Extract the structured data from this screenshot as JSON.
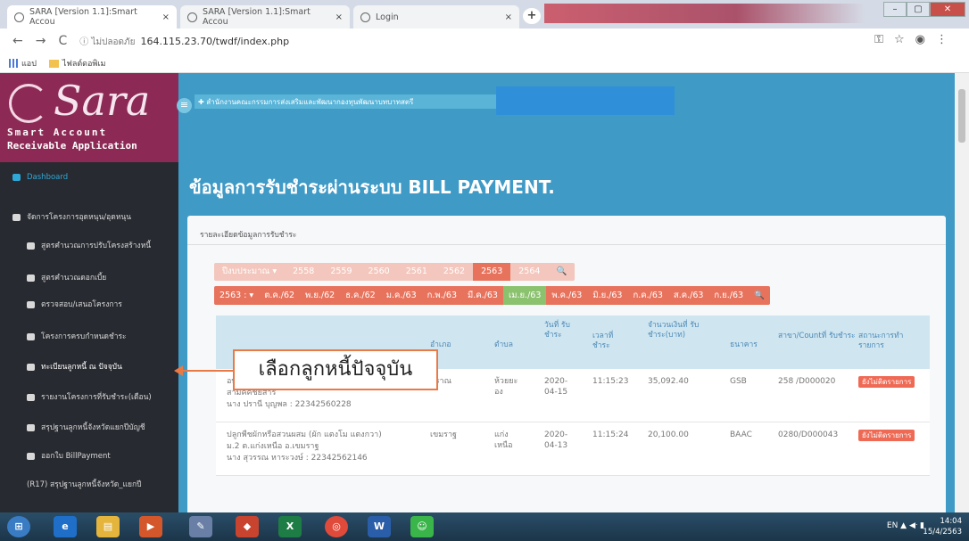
{
  "browser": {
    "tabs": [
      {
        "title": "SARA [Version 1.1]:Smart Accou",
        "close": "×"
      },
      {
        "title": "SARA [Version 1.1]:Smart Accou",
        "close": "×"
      },
      {
        "title": "Login",
        "close": "×"
      }
    ],
    "new_tab": "+",
    "window_controls": {
      "minimize": "–",
      "maximize": "▢",
      "close": "✕"
    },
    "nav": {
      "back": "←",
      "forward": "→",
      "reload": "C"
    },
    "security_label": "ⓘ ไม่ปลอดภัย",
    "url": "164.115.23.70/twdf/index.php",
    "bookmarks": [
      {
        "icon": "apps-grid-icon",
        "label": "แอป"
      },
      {
        "icon": "folder-icon",
        "label": "ไฟลต์ดอพิเม"
      }
    ]
  },
  "app": {
    "logo": {
      "name": "Sara",
      "sub1": "Smart Account",
      "sub2": "Receivable Application"
    },
    "menu_toggle": "≡",
    "breadcrumb": "✚ สำนักงานคณะกรรมการส่งเสริมและพัฒนากองทุนพัฒนาบทบาทสตรี"
  },
  "sidebar": {
    "items": [
      {
        "label": "Dashboard",
        "icon": "dashboard-icon"
      },
      {
        "label": "จัดการโครงการอุดหนุน/อุดหนุน",
        "icon": "megaphone-icon"
      },
      {
        "label": "สูตรคำนวณการปรับโครงสร้างหนี้",
        "icon": "user-icon"
      },
      {
        "label": "สูตรคำนวณดอกเบี้ย",
        "icon": "user-icon"
      },
      {
        "label": "ตรวจสอบ/เสนอโครงการ",
        "icon": "user-icon"
      },
      {
        "label": "โครงการครบกำหนดชำระ",
        "icon": "user-icon"
      },
      {
        "label": "ทะเบียนลูกหนี้ ณ ปัจจุบัน",
        "icon": "user-icon"
      },
      {
        "label": "รายงานโครงการที่รับชำระ(เดือน)",
        "icon": "user-icon"
      },
      {
        "label": "สรุปฐานลูกหนี้จังหวัดแยกปีบัญชี",
        "icon": "user-icon"
      },
      {
        "label": "ออกใบ BillPayment",
        "icon": "bill-icon"
      },
      {
        "label": "(R17) สรุปฐานลูกหนี้จังหวัด_แยกปี",
        "icon": ""
      }
    ]
  },
  "main": {
    "title": "ข้อมูลการรับชำระผ่านระบบ BILL PAYMENT.",
    "panel_heading": "รายละเอียดข้อมูลการรับชำระ",
    "years": [
      "ปีงบประมาณ ▾",
      "2558",
      "2559",
      "2560",
      "2561",
      "2562",
      "2563",
      "2564",
      "🔍"
    ],
    "selected_year": "2563",
    "months": [
      "2563 : ▾",
      "ต.ค./62",
      "พ.ย./62",
      "ธ.ค./62",
      "ม.ค./63",
      "ก.พ./63",
      "มี.ค./63",
      "เม.ย./63",
      "พ.ค./63",
      "มิ.ย./63",
      "ก.ค./63",
      "ส.ค./63",
      "ก.ย./63",
      "🔍"
    ],
    "selected_month": "เม.ย./63",
    "table": {
      "headers": [
        "",
        "อำเภอ",
        "ตำบล",
        "วันที่ รับ ชำระ",
        "เวลาที่ ชำระ",
        "จำนวนเงินที่ รับ ชำระ(บาท)",
        "ธนาคาร",
        "สาขา/Countที่ รับชำระ",
        "สถานะการทำ รายการ"
      ],
      "rows": [
        {
          "line1": "อบ",
          "line2": "สามัคคีชัยสารี",
          "line3": "นาง ปรานี บุญพล : 22342560228",
          "amphoe": "ปราณ",
          "tambon": "ห้วยยะ อง",
          "date": "2020-04-15",
          "time": "11:15:23",
          "amount": "35,092.40",
          "bank": "GSB",
          "branch": "258 /D000020",
          "status": "ยังไม่ติดรายการ"
        },
        {
          "line1": "ปลูกพืชผักหรือสวนผสม (ผัก แตงโม แตงกวา)",
          "line2": "ม.2 ต.แก่งเหนือ อ.เขมราฐ",
          "line3": "นาง สุวรรณ หาระวงษ์ : 22342562146",
          "amphoe": "เขมราฐ",
          "tambon": "แก่ง เหนือ",
          "date": "2020-04-13",
          "time": "11:15:24",
          "amount": "20,100.00",
          "bank": "BAAC",
          "branch": "0280/D000043",
          "status": "ยังไม่ติดรายการ"
        }
      ]
    }
  },
  "callout": {
    "text": "เลือกลูกหนี้ปัจจุบัน"
  },
  "taskbar": {
    "apps": [
      "⊞",
      "e",
      "▤",
      "▶",
      "✎",
      "◆",
      "X",
      "◎",
      "W",
      "☺"
    ],
    "tray": "EN ▲ ◀ᐧ ▮",
    "time": "14:04",
    "date": "15/4/2563"
  },
  "colors": {
    "brand": "#8c2a55",
    "header": "#3f9ac6",
    "sidebar": "#272a30",
    "filter": "#e8735d",
    "selected_month": "#8ac26e",
    "badge": "#ef6a55"
  }
}
